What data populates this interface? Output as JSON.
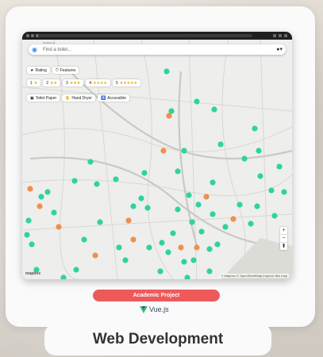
{
  "app": {
    "search_placeholder": "Find a toilet...",
    "search_subtitle": "findtoilet.sg",
    "account_icon": "account-circle-icon",
    "filters_row1": [
      {
        "label": "Rating",
        "icon": "star-icon"
      },
      {
        "label": "Features",
        "icon": "shield-icon"
      }
    ],
    "ratings_row": [
      {
        "num": "1",
        "stars": "★"
      },
      {
        "num": "2",
        "stars": "★★"
      },
      {
        "num": "3",
        "stars": "★★★"
      },
      {
        "num": "4",
        "stars": "★★★★"
      },
      {
        "num": "5",
        "stars": "★★★★★"
      }
    ],
    "features_row": [
      {
        "label": "Toilet Paper",
        "icon": "toilet-paper-icon"
      },
      {
        "label": "Hand Dryer",
        "icon": "hand-dryer-icon"
      },
      {
        "label": "Accessible",
        "icon": "wheelchair-icon"
      }
    ],
    "zoom_in": "+",
    "zoom_out": "−",
    "compass": "⬆",
    "attribution": "© Mapbox © OpenStreetMap  Improve this map",
    "map_logo": "mapbox",
    "marker_colors": {
      "primary": "#2ed3a0",
      "secondary": "#f0904a"
    }
  },
  "project_badge": "Academic Project",
  "framework": "Vue.js",
  "caption": "Web Development"
}
